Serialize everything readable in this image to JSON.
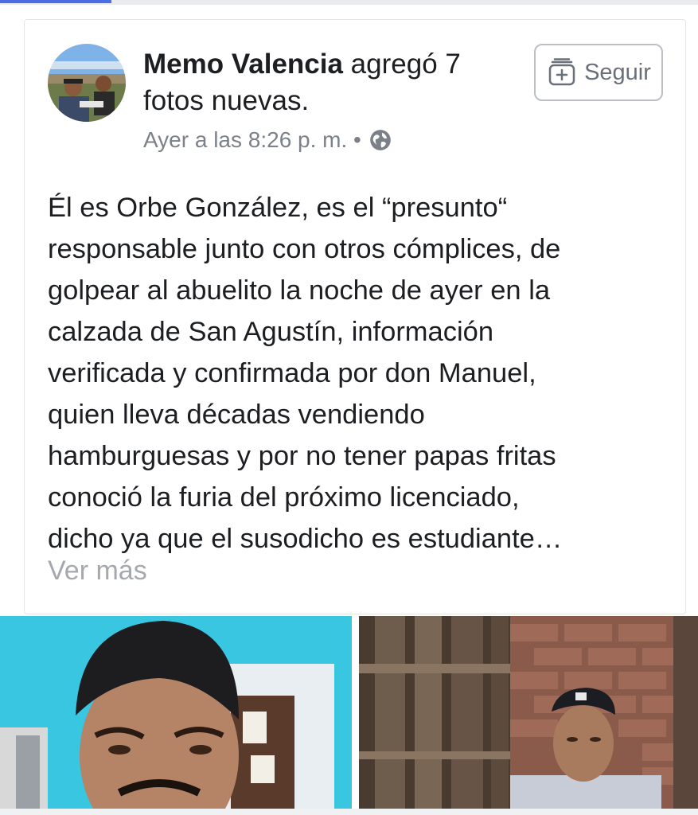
{
  "post": {
    "author": "Memo Valencia",
    "action": " agregó 7 fotos nuevas.",
    "time": "Ayer a las 8:26 p. m. •",
    "privacy_icon": "globe-icon",
    "follow_label": "Seguir",
    "body_lines": [
      "Él es Orbe González, es el “presunto“",
      "responsable junto con otros cómplices, de",
      "golpear al abuelito la noche de ayer en la",
      "calzada de San Agustín, información",
      "verificada y confirmada por don Manuel,",
      "quien lleva décadas vendiendo",
      "hamburguesas y por no tener papas fritas",
      "conoció la furia del próximo licenciado,",
      "dicho ya que el susodicho es estudiante…"
    ],
    "see_more": "Ver más"
  },
  "colors": {
    "text": "#1c1e21",
    "meta": "#7c8189",
    "see_more": "#a5a8ad",
    "accent": "#4b6ee6"
  }
}
